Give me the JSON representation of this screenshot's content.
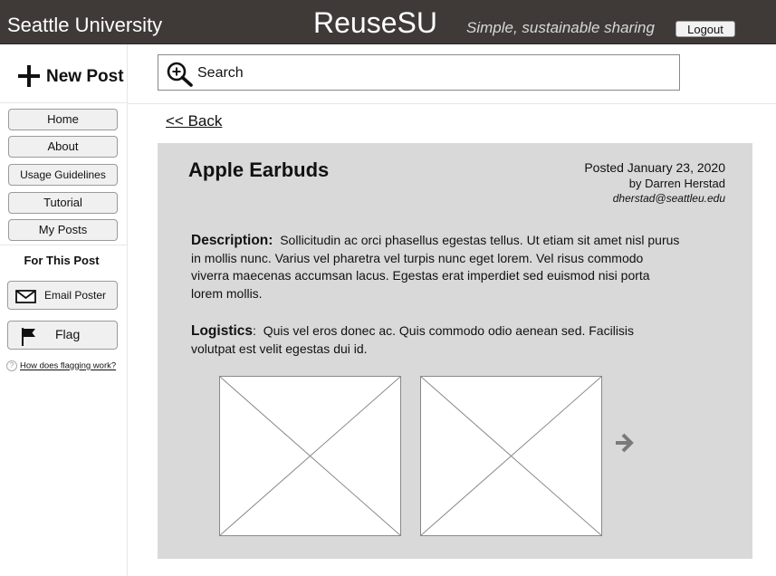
{
  "header": {
    "org_name": "Seattle University",
    "brand": "ReuseSU",
    "tagline": "Simple, sustainable sharing",
    "logout_label": "Logout"
  },
  "new_post": {
    "label": "New Post",
    "icon": "plus-icon"
  },
  "search": {
    "placeholder": "Search",
    "icon": "search-icon"
  },
  "sidebar": {
    "nav": [
      {
        "label": "Home"
      },
      {
        "label": "About"
      },
      {
        "label": "Usage Guidelines"
      },
      {
        "label": "Tutorial"
      },
      {
        "label": "My Posts"
      }
    ],
    "section_title": "For This Post",
    "email_label": "Email Poster",
    "email_icon": "envelope-icon",
    "flag_label": "Flag",
    "flag_icon": "flag-icon",
    "help_link": "How does flagging work?"
  },
  "post": {
    "back_label": "<< Back",
    "title": "Apple Earbuds",
    "posted": "Posted January 23, 2020",
    "author": "by Darren Herstad",
    "email": "dherstad@seattleu.edu",
    "description_label": "Description:",
    "description": "Sollicitudin ac orci phasellus egestas tellus. Ut etiam sit amet nisl purus in mollis nunc. Varius vel pharetra vel turpis nunc eget lorem. Vel risus commodo viverra maecenas accumsan lacus. Egestas erat imperdiet sed euismod nisi porta lorem mollis.",
    "logistics_label": "Logistics",
    "logistics": "Quis vel eros donec ac. Quis commodo odio aenean sed. Facilisis volutpat est velit egestas dui id.",
    "next_icon": "arrow-right-icon"
  },
  "colors": {
    "header_bg": "#3f3a38",
    "card_bg": "#d9d9d9",
    "button_bg": "#f0f0f0"
  }
}
